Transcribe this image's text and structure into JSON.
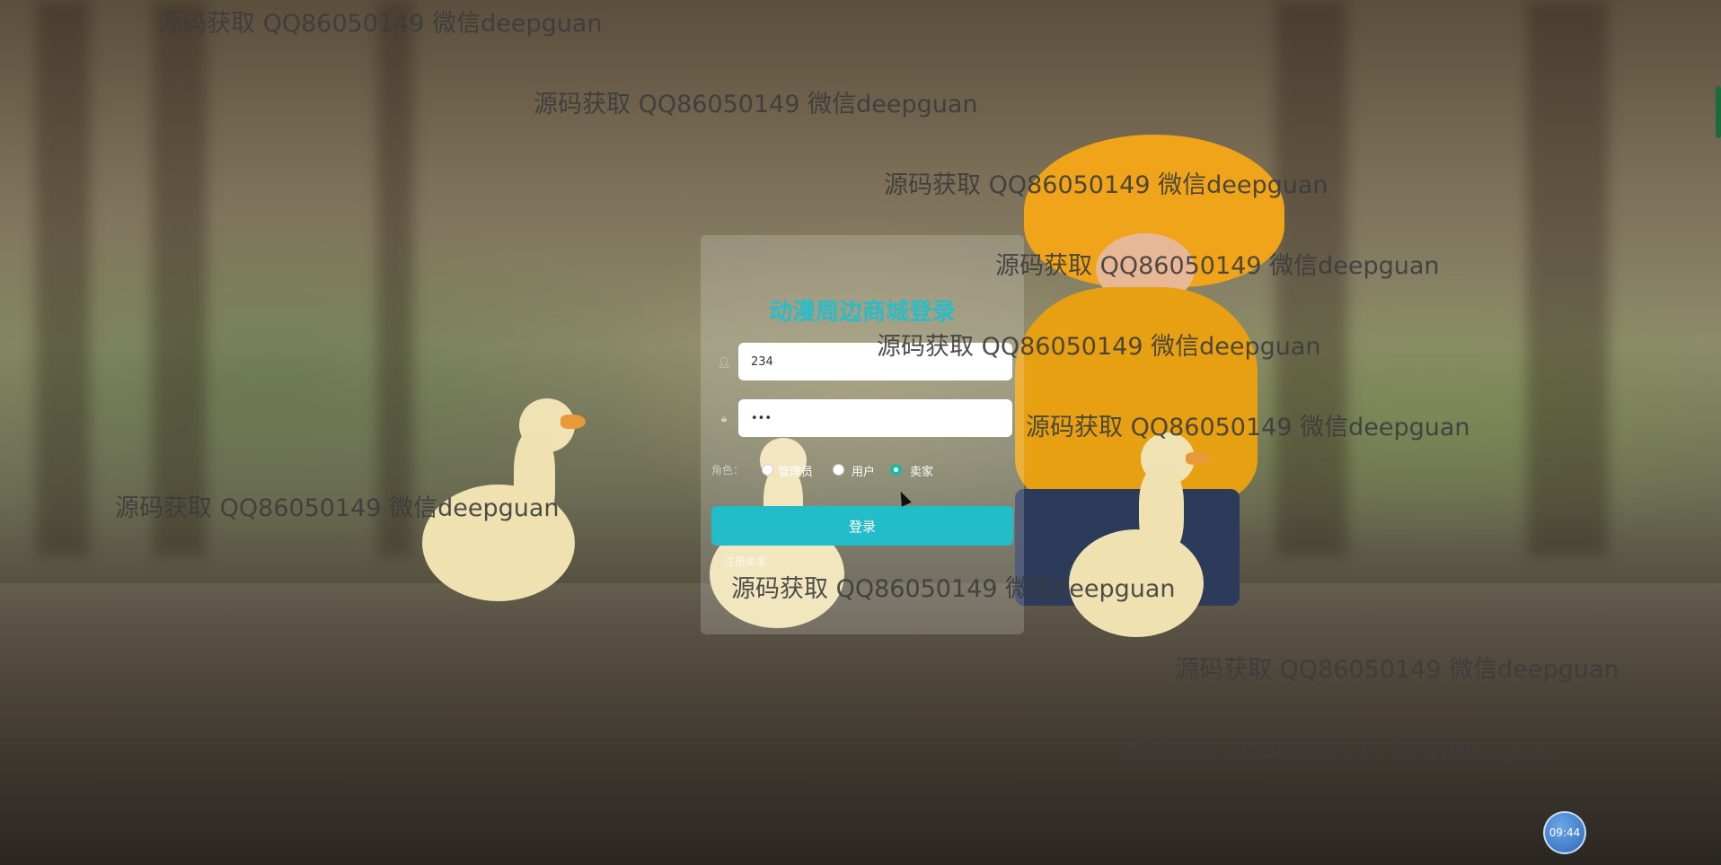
{
  "login": {
    "title": "动漫周边商城登录",
    "username_value": "234",
    "password_value": "•••",
    "role_label": "角色：",
    "roles": [
      "管理员",
      "用户",
      "卖家"
    ],
    "selected_role": "卖家",
    "login_button": "登录",
    "register_link": "注册卖家",
    "icons": {
      "user": "user-icon",
      "lock": "lock-icon"
    },
    "accent_color": "#22bdc9"
  },
  "watermarks": [
    "源码获取 QQ86050149 微信deepguan",
    "源码获取 QQ86050149 微信deepguan",
    "源码获取 QQ86050149 微信deepguan",
    "源码获取 QQ86050149 微信deepguan",
    "源码获取 QQ86050149 微信deepguan",
    "源码获取 QQ86050149 微信deepguan",
    "源码获取 QQ86050149 微信deepguan",
    "源码获取 QQ86050149 微信deepguan",
    "源码获取 QQ86050149 微信deepguan",
    "源码获取 QQ86050149 微信deepguan"
  ],
  "clock": {
    "time": "09:44"
  }
}
